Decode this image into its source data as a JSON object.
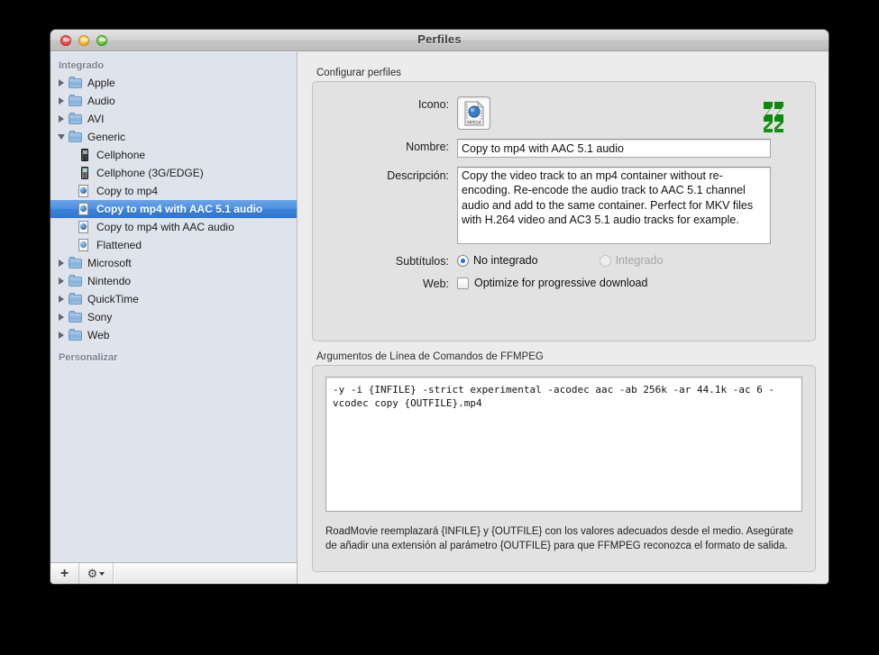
{
  "window": {
    "title": "Perfiles",
    "controls": {
      "close": "close-button",
      "minimize": "minimize-button",
      "zoom": "zoom-button"
    }
  },
  "sidebar": {
    "sections": [
      {
        "header": "Integrado"
      },
      {
        "header": "Personalizar"
      }
    ],
    "header_builtin": "Integrado",
    "header_custom": "Personalizar",
    "items": [
      {
        "label": "Apple",
        "icon": "folder-icon",
        "level": 1,
        "expanded": false,
        "selected": false
      },
      {
        "label": "Audio",
        "icon": "folder-icon",
        "level": 1,
        "expanded": false,
        "selected": false
      },
      {
        "label": "AVI",
        "icon": "folder-icon",
        "level": 1,
        "expanded": false,
        "selected": false
      },
      {
        "label": "Generic",
        "icon": "folder-icon",
        "level": 1,
        "expanded": true,
        "selected": false
      },
      {
        "label": "Cellphone",
        "icon": "phone-icon",
        "level": 2,
        "expanded": null,
        "selected": false
      },
      {
        "label": "Cellphone (3G/EDGE)",
        "icon": "phone-icon",
        "level": 2,
        "expanded": null,
        "selected": false
      },
      {
        "label": "Copy to mp4",
        "icon": "mpeg4-doc-icon",
        "level": 2,
        "expanded": null,
        "selected": false
      },
      {
        "label": "Copy to mp4 with AAC 5.1 audio",
        "icon": "mpeg4-doc-icon",
        "level": 2,
        "expanded": null,
        "selected": true
      },
      {
        "label": "Copy to mp4 with AAC audio",
        "icon": "mpeg4-doc-icon",
        "level": 2,
        "expanded": null,
        "selected": false
      },
      {
        "label": "Flattened",
        "icon": "mov-doc-icon",
        "level": 2,
        "expanded": null,
        "selected": false
      },
      {
        "label": "Microsoft",
        "icon": "folder-icon",
        "level": 1,
        "expanded": false,
        "selected": false
      },
      {
        "label": "Nintendo",
        "icon": "folder-icon",
        "level": 1,
        "expanded": false,
        "selected": false
      },
      {
        "label": "QuickTime",
        "icon": "folder-icon",
        "level": 1,
        "expanded": false,
        "selected": false
      },
      {
        "label": "Sony",
        "icon": "folder-icon",
        "level": 1,
        "expanded": false,
        "selected": false
      },
      {
        "label": "Web",
        "icon": "folder-icon",
        "level": 1,
        "expanded": false,
        "selected": false
      }
    ],
    "toolbar": {
      "add_label": "+",
      "gear_label": "⚙",
      "add_icon": "plus-icon",
      "gear_icon": "gear-icon"
    }
  },
  "main": {
    "config_group_label": "Configurar perfiles",
    "fields": {
      "icon_label": "Icono:",
      "icon_glyph_caption": "MPEG4",
      "name_label": "Nombre:",
      "name_value": "Copy to mp4 with AAC 5.1 audio",
      "desc_label": "Descripción:",
      "desc_value": "Copy the video track to an mp4 container without re-encoding. Re-encode the audio track to AAC 5.1 channel audio and add to the same container. Perfect for MKV files with H.264 video and AC3 5.1 audio tracks for example.",
      "subtitles_label": "Subtítulos:",
      "subtitles_option_not_embedded": "No integrado",
      "subtitles_option_embedded": "Integrado",
      "subtitles_selected": "No integrado",
      "web_label": "Web:",
      "web_checkbox_label": "Optimize for progressive download",
      "web_checked": false
    },
    "args_group_label": "Argumentos de Línea de Comandos de FFMPEG",
    "args_value": "-y -i {INFILE} -strict experimental -acodec aac -ab 256k -ar 44.1k -ac 6 -vcodec copy {OUTFILE}.mp4",
    "args_help": "RoadMovie reemplazará {INFILE} y {OUTFILE} con los valores adecuados desde el medio. Asegúrate de añadir una extensión al parámetro {OUTFILE} para que  FFMPEG reconozca el formato de salida."
  },
  "colors": {
    "selection_blue": "#3b82da",
    "sidebar_bg": "#dfe4ec",
    "panel_bg": "#ececec",
    "group_bg": "#e2e2e2",
    "ffmpeg_green": "#0b8a0b",
    "radio_blue": "#2d6fc9"
  }
}
